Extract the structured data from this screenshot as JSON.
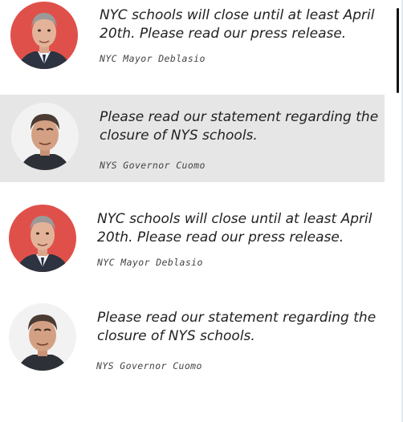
{
  "feed": {
    "items": [
      {
        "message": "NYC schools will close until at least April 20th. Please read our press release.",
        "author": "NYC Mayor Deblasio",
        "avatar": "mayor-deblasio-photo",
        "highlighted": false
      },
      {
        "message": "Please read our statement regarding the closure of NYS schools.",
        "author": "NYS Governor Cuomo",
        "avatar": "governor-cuomo-photo",
        "highlighted": true
      },
      {
        "message": "NYC schools will close until at least April 20th. Please read our press release.",
        "author": "NYC Mayor Deblasio",
        "avatar": "mayor-deblasio-photo",
        "highlighted": false
      },
      {
        "message": "Please read our statement regarding the closure of NYS schools.",
        "author": "NYS Governor Cuomo",
        "avatar": "governor-cuomo-photo",
        "highlighted": false
      }
    ]
  },
  "colors": {
    "highlight_background": "#e6e6e6",
    "deblasio_avatar_background": "#e0504a",
    "text": "#222222"
  }
}
